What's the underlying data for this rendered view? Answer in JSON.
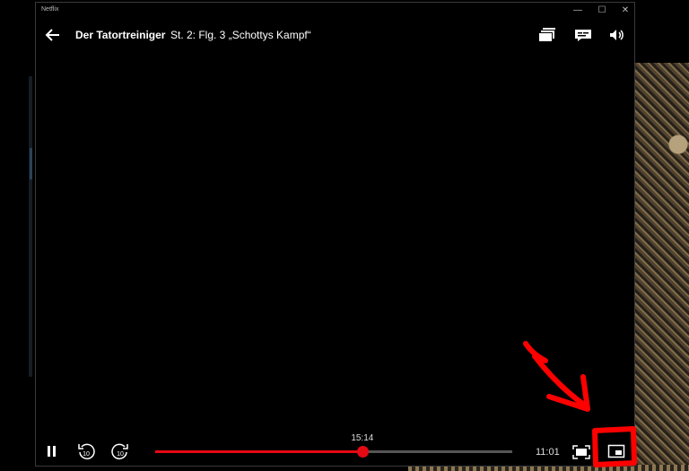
{
  "window": {
    "app_title": "Netflix",
    "controls": {
      "minimize": "—",
      "maximize": "☐",
      "close": "✕"
    }
  },
  "header": {
    "show_title": "Der Tatortreiniger",
    "episode_title": "St. 2: Flg. 3 „Schottys Kampf“",
    "icons": [
      "back-arrow-icon",
      "episodes-icon",
      "subtitles-icon",
      "volume-icon"
    ]
  },
  "player": {
    "current_time": "15:14",
    "remaining_time": "11:01",
    "progress_fraction": 0.58,
    "skip_seconds": "10",
    "accent_color": "#e50914"
  },
  "annotation": {
    "color": "#ff0000"
  }
}
